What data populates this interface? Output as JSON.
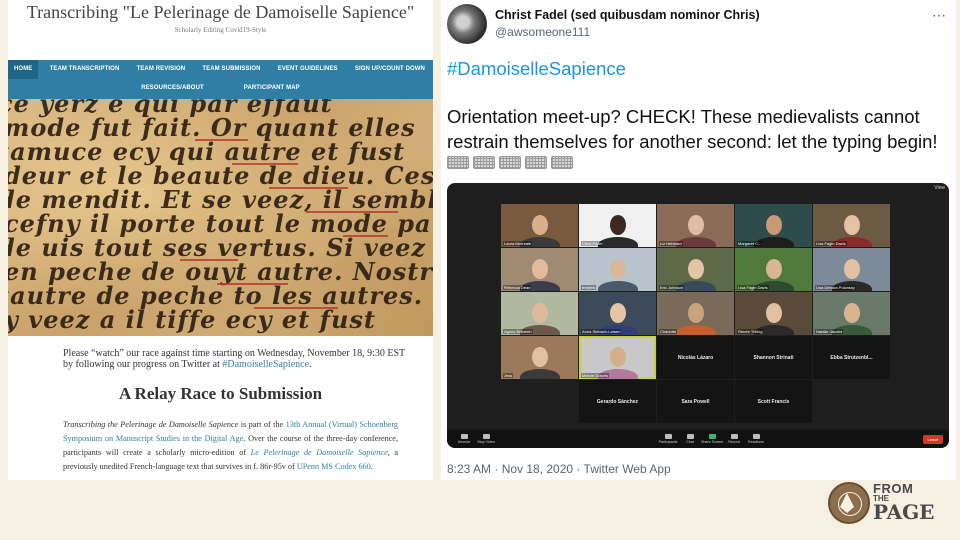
{
  "site": {
    "title": "Transcribing \"Le Pelerinage de Damoiselle Sapience\"",
    "tagline": "Scholarly Editing Covid19-Style",
    "nav_row1": [
      "HOME",
      "TEAM TRANSCRIPTION",
      "TEAM REVISION",
      "TEAM SUBMISSION",
      "EVENT GUIDELINES",
      "SIGN UP/COUNT DOWN"
    ],
    "nav_row2": [
      "RESOURCES/ABOUT",
      "PARTICIPANT MAP"
    ],
    "manuscript_lines": [
      "ce yerz e qui par effaut",
      "mode fut fait. Or quant elles",
      "tamuce ecy qui autre et fust",
      "deur et le beaute de dieu. Cest spendozs",
      "de mendit. Et se veez, il semble fieble",
      "cefny il porte tout le mode par sa vertu",
      "de uis tout ses vertus. Si veez il sefiible estre",
      "en peche de ouyt autre. Nostre il espirage",
      "tautre de peche to les autres. Ouycuide",
      "y veez a il tiffe ecy et fust"
    ],
    "announce": {
      "text1": "Please “watch” our race against time starting on Wednesday, November 18, 9:30 EST by following our progress on Twitter at ",
      "link": "#DamoiselleSapience",
      "text2": "."
    },
    "section_title": "A Relay Race to Submission",
    "paragraph": {
      "italic_title": "Transcribing the Pelerinage de Damoiselle Sapience",
      "p1": " is part of the ",
      "link1": "13th Annual (Virtual) Schoenberg Symposium on Manuscript Studies in the Digital Age",
      "p2": ". Over the course of the three-day conference, participants will create a scholarly micro-edition of ",
      "link2": "Le Pelerinage de Damoiselle Sapience",
      "p3": ", a previously unedited French-language text that survives in f. 86r-95v of ",
      "link3": "UPenn MS Codex 660",
      "p4": "."
    }
  },
  "tweet": {
    "display_name": "Christ Fadel (sed quibusdam nominor Chris)",
    "handle": "@awsomeone111",
    "more_icon": "more-horizontal-icon",
    "hashtag": "#DamoiselleSapience",
    "text": "Orientation meet-up? CHECK! These medievalists cannot restrain themselves for another second: let the typing begin!",
    "keyboard_emoji_count": 5,
    "meta": "8:23 AM · Nov 18, 2020 · Twitter Web App",
    "zoom": {
      "top_label": "View",
      "tiles": [
        {
          "name": "Laura Morreale",
          "bg": "#7a5a3f",
          "face": "#d9b08c",
          "shirt": "#3a3a3a"
        },
        {
          "name": "Chris Fadel",
          "bg": "#f0f0f0",
          "face": "#3c2a1f",
          "shirt": "#2a2a2a"
        },
        {
          "name": "Liz Hebbard",
          "bg": "#8a6b58",
          "face": "#e0bda0",
          "shirt": "#6c3a3a"
        },
        {
          "name": "Margaret C...",
          "bg": "#2e4c4c",
          "face": "#c89a74",
          "shirt": "#1e1e1e"
        },
        {
          "name": "Lisa Fagin Davis",
          "bg": "#6d5a44",
          "face": "#e3c2a5",
          "shirt": "#8a2a2a"
        },
        {
          "name": "Rebecca Dean",
          "bg": "#a08a72",
          "face": "#e1bb9a",
          "shirt": "#3b3b4a"
        },
        {
          "name": "frederik",
          "bg": "#b8c4cc",
          "face": "#d8b89a",
          "shirt": "#4a5a6a"
        },
        {
          "name": "Eric Johnson",
          "bg": "#5c6a4a",
          "face": "#e5c5a5",
          "shirt": "#3a4a5a"
        },
        {
          "name": "Lisa Fagin Davis",
          "bg": "#4f7a3a",
          "face": "#d9b596",
          "shirt": "#2f4a2f"
        },
        {
          "name": "Lisa Debora Polonsky",
          "bg": "#7c8a9a",
          "face": "#e2c0a2",
          "shirt": "#2a2a2a"
        },
        {
          "name": "Agnes Brillstein",
          "bg": "#b0b8a0",
          "face": "#dcb99a",
          "shirt": "#6b5a4a"
        },
        {
          "name": "Anna Siebach-Larsen",
          "bg": "#3d4a5a",
          "face": "#e6c4a6",
          "shirt": "#2f3f7a"
        },
        {
          "name": "Charlotte",
          "bg": "#7a6a5a",
          "face": "#c9a37e",
          "shirt": "#c65f2a"
        },
        {
          "name": "Renée Trilling",
          "bg": "#5a4a3a",
          "face": "#e0c0a0",
          "shirt": "#2a2a2a"
        },
        {
          "name": "Natalie Jacobs",
          "bg": "#6a7a6a",
          "face": "#d8b491",
          "shirt": "#3a5a3a"
        },
        {
          "name": "Jess",
          "bg": "#9a7a5a",
          "face": "#e1bf9f",
          "shirt": "#3a3a3a"
        },
        {
          "name": "Marcie Graves",
          "bg": "#c8c8c8",
          "face": "#d6ae8c",
          "shirt": "#b27a9a",
          "speaking": true
        },
        {
          "name": "Nicolás Lázaro",
          "black": true
        },
        {
          "name": "Shannon Strinati",
          "black": true
        },
        {
          "name": "Ebba Strutzenbl...",
          "black": true
        },
        {
          "name": "",
          "empty": true
        },
        {
          "name": "Gerardo Sánchez",
          "black": true
        },
        {
          "name": "Sara Powell",
          "black": true
        },
        {
          "name": "Scott Francis",
          "black": true
        }
      ],
      "controls": [
        {
          "label": "Unmute",
          "name": "unmute-button"
        },
        {
          "label": "Stop Video",
          "name": "stop-video-button"
        },
        {
          "label": "Participants",
          "name": "participants-button"
        },
        {
          "label": "Chat",
          "name": "chat-button"
        },
        {
          "label": "Share Screen",
          "name": "share-screen-button"
        },
        {
          "label": "Record",
          "name": "record-button"
        },
        {
          "label": "Reactions",
          "name": "reactions-button"
        }
      ],
      "leave_label": "Leave"
    }
  },
  "logo": {
    "from": "FROM",
    "the": "THE",
    "page": "PAGE",
    "brand_color": "#8d6e4c"
  }
}
